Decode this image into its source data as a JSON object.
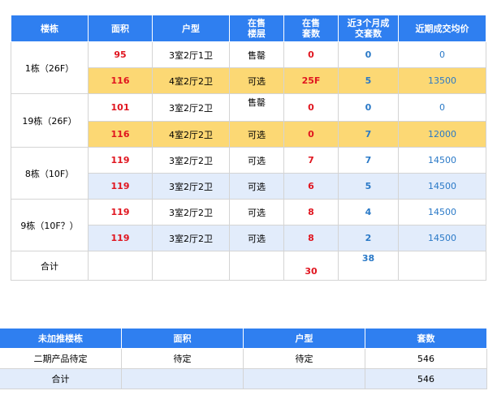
{
  "sales_table": {
    "headers": [
      "楼栋",
      "面积",
      "户型",
      "在售\n楼层",
      "在售\n套数",
      "近3个月成\n交套数",
      "近期成交均价"
    ],
    "header_lines": {
      "floor": [
        "在售",
        "楼层"
      ],
      "units": [
        "在售",
        "套数"
      ],
      "recent": [
        "近3个月成",
        "交套数"
      ]
    },
    "buildings": [
      "1栋（26F）",
      "19栋（26F）",
      "8栋（10F）",
      "9栋（10F？）"
    ],
    "rows": [
      {
        "area": "95",
        "layout": "3室2厅1卫",
        "floor": "售罄",
        "units": "0",
        "recent": "0",
        "price": "0"
      },
      {
        "area": "116",
        "layout": "4室2厅2卫",
        "floor": "可选",
        "units": "25F",
        "recent": "5",
        "price": "13500"
      },
      {
        "area": "101",
        "layout": "3室2厅2卫",
        "floor": "售罄",
        "units": "0",
        "recent": "0",
        "price": "0"
      },
      {
        "area": "116",
        "layout": "4室2厅2卫",
        "floor": "可选",
        "units": "0",
        "recent": "7",
        "price": "12000"
      },
      {
        "area": "119",
        "layout": "3室2厅2卫",
        "floor": "可选",
        "units": "7",
        "recent": "7",
        "price": "14500"
      },
      {
        "area": "119",
        "layout": "3室2厅2卫",
        "floor": "可选",
        "units": "6",
        "recent": "5",
        "price": "14500"
      },
      {
        "area": "119",
        "layout": "3室2厅2卫",
        "floor": "可选",
        "units": "8",
        "recent": "4",
        "price": "14500"
      },
      {
        "area": "119",
        "layout": "3室2厅2卫",
        "floor": "可选",
        "units": "8",
        "recent": "2",
        "price": "14500"
      }
    ],
    "total": {
      "label": "合计",
      "units": "30",
      "recent": "38"
    }
  },
  "pending_table": {
    "headers": [
      "未加推楼栋",
      "面积",
      "户型",
      "套数"
    ],
    "rows": [
      {
        "building": "二期产品待定",
        "area": "待定",
        "layout": "待定",
        "units": "546"
      }
    ],
    "total": {
      "label": "合计",
      "units": "546"
    }
  },
  "colors": {
    "header_bg": "#2f7ff0",
    "highlight_yellow": "#fcd874",
    "highlight_blue": "#e2ecfb",
    "red_text": "#e0151f",
    "blue_text": "#2a79c7"
  }
}
